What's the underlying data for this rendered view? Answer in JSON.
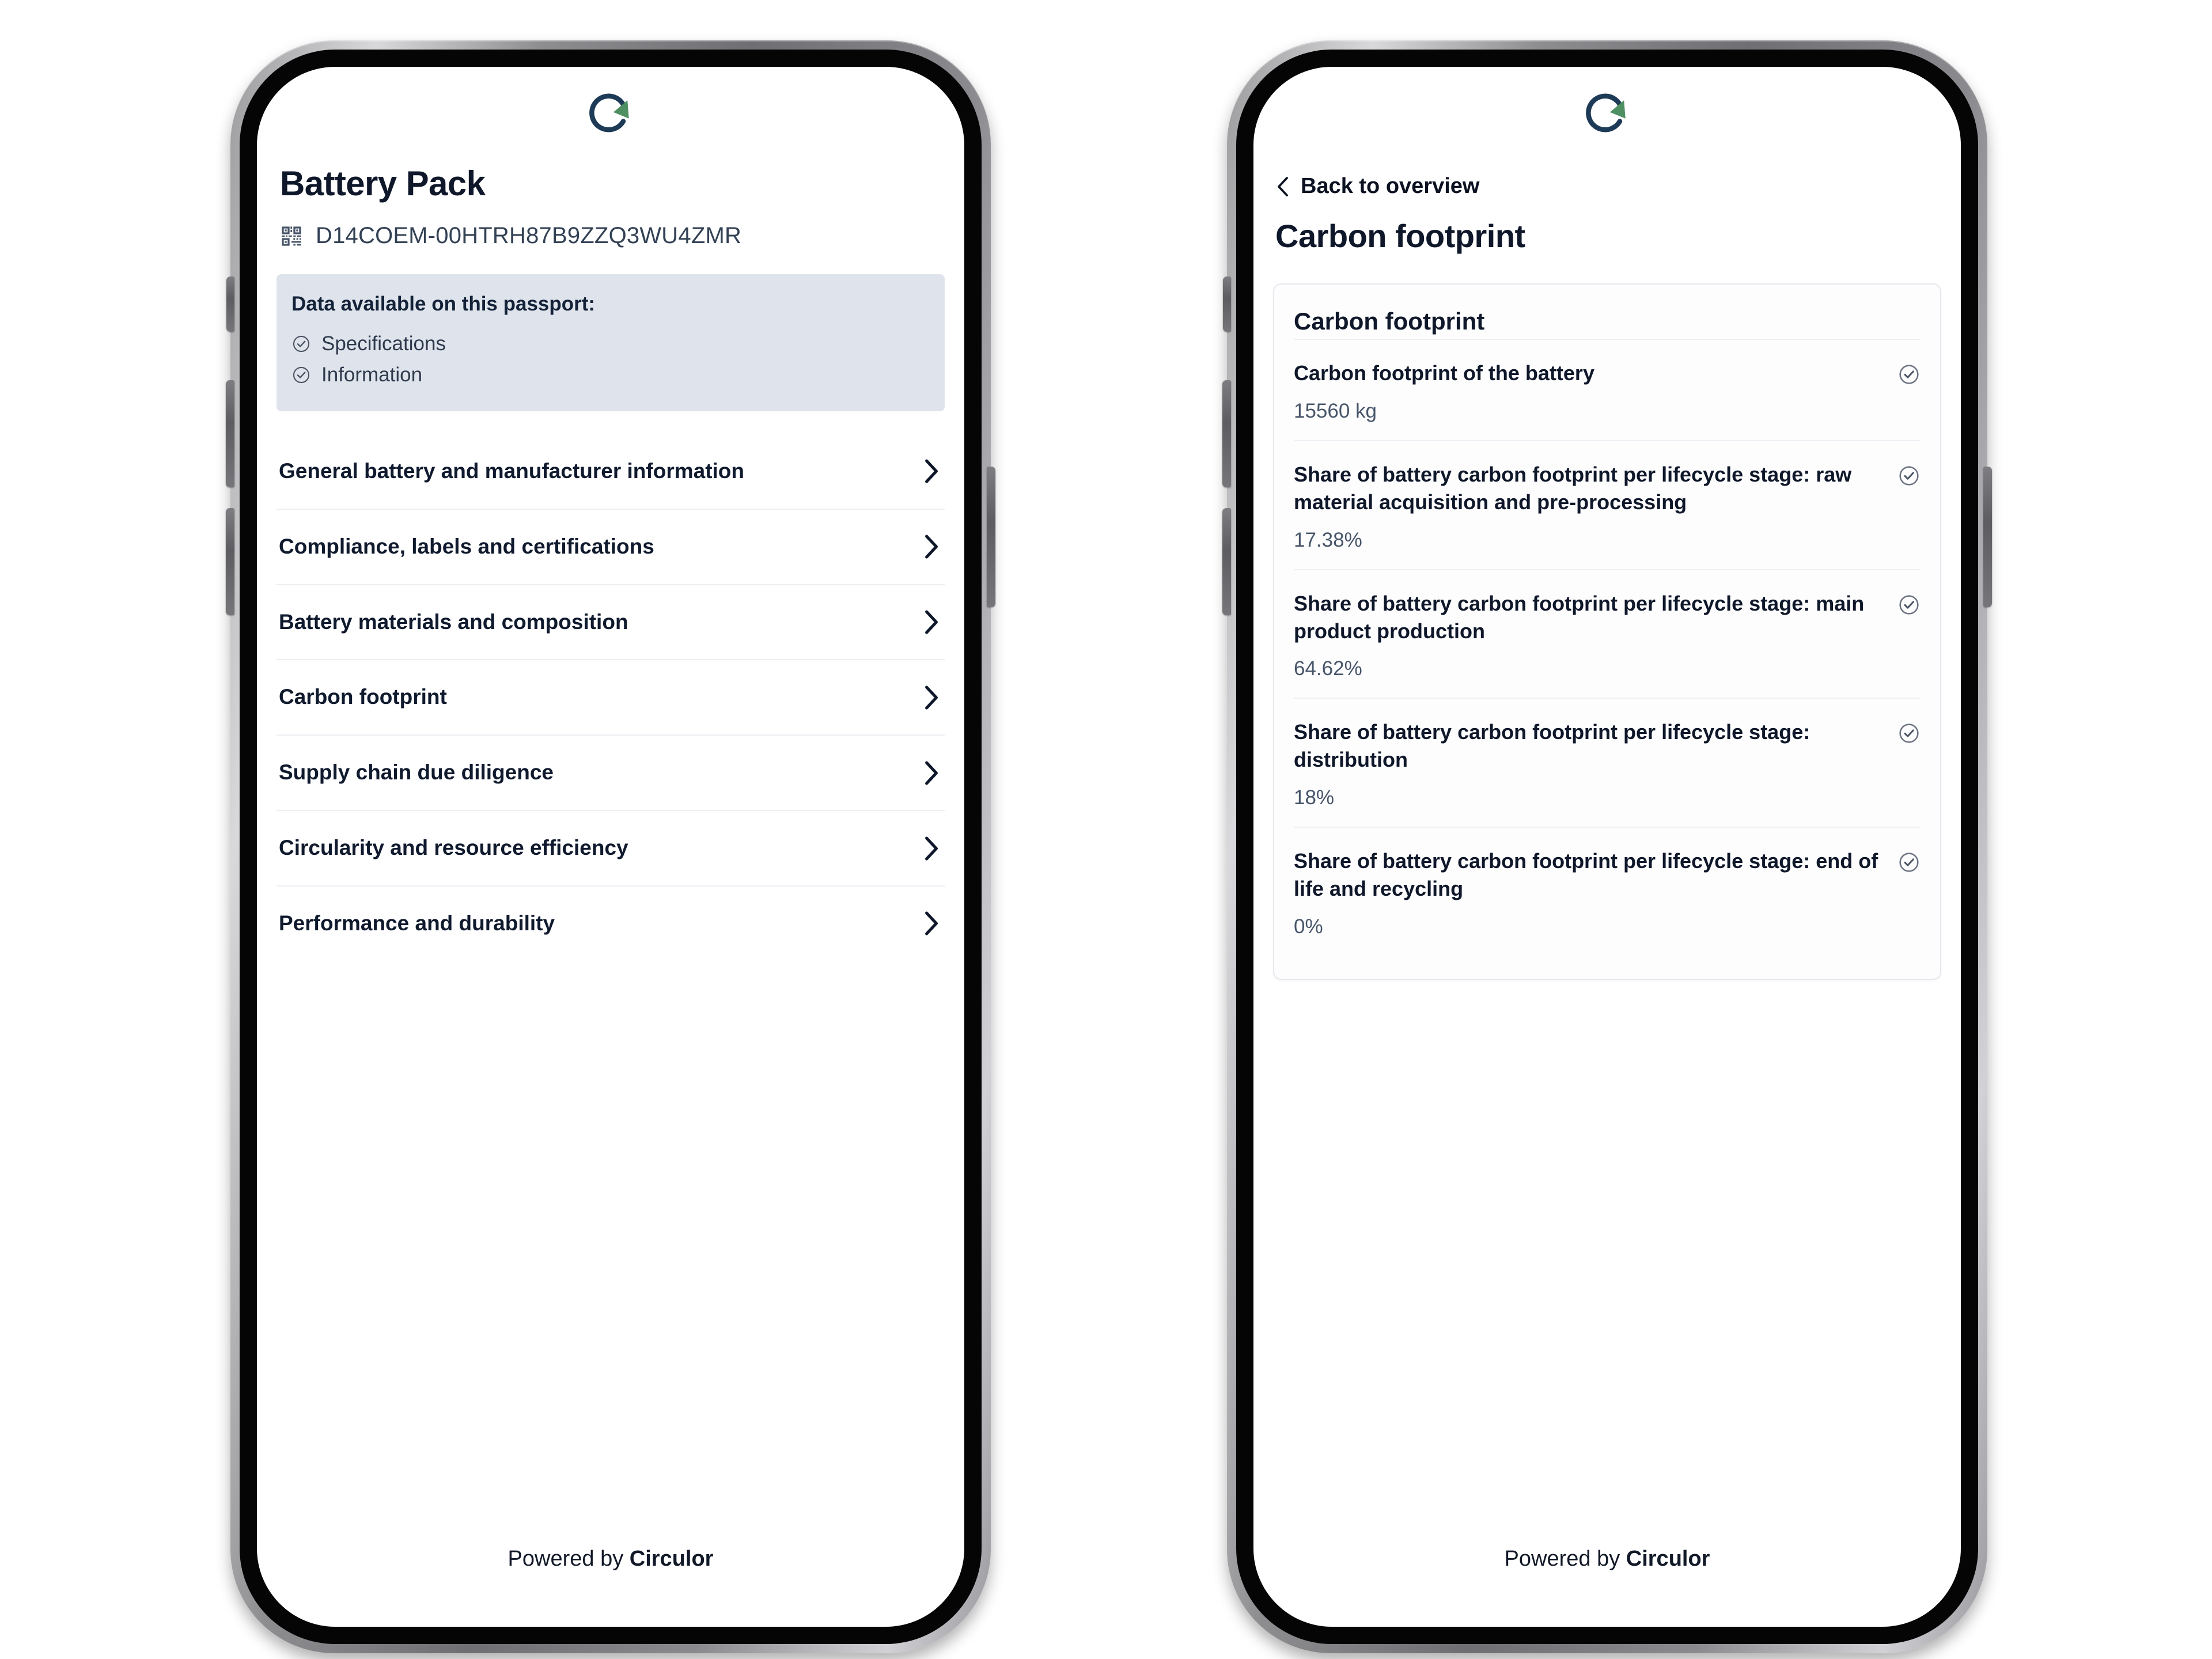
{
  "brand": {
    "logo_icon": "circular-arrow-logo",
    "logo_ring_color": "#1d3a57",
    "logo_arrow_color": "#4f9063",
    "footer_prefix": "Powered by ",
    "footer_name": "Circulor"
  },
  "left_screen": {
    "title": "Battery Pack",
    "qr_icon": "qr-code-icon",
    "passport_id": "D14COEM-00HTRH87B9ZZQ3WU4ZMR",
    "availability": {
      "heading": "Data available on this passport:",
      "items": [
        {
          "label": "Specifications",
          "icon": "check-circle-icon"
        },
        {
          "label": "Information",
          "icon": "check-circle-icon"
        }
      ],
      "background_color": "#dfe4ec"
    },
    "menu": [
      {
        "label": "General battery and manufacturer information",
        "chevron": "chevron-right-icon"
      },
      {
        "label": "Compliance, labels and certifications",
        "chevron": "chevron-right-icon"
      },
      {
        "label": "Battery materials and composition",
        "chevron": "chevron-right-icon"
      },
      {
        "label": "Carbon footprint",
        "chevron": "chevron-right-icon"
      },
      {
        "label": "Supply chain due diligence",
        "chevron": "chevron-right-icon"
      },
      {
        "label": "Circularity and resource efficiency",
        "chevron": "chevron-right-icon"
      },
      {
        "label": "Performance and durability",
        "chevron": "chevron-right-icon"
      }
    ]
  },
  "right_screen": {
    "back_icon": "chevron-left-icon",
    "back_label": "Back to overview",
    "title": "Carbon footprint",
    "card": {
      "title": "Carbon footprint",
      "rows": [
        {
          "label": "Carbon footprint of the battery",
          "value": "15560 kg",
          "icon": "check-circle-icon"
        },
        {
          "label": "Share of battery carbon footprint per lifecycle stage: raw material acquisition and pre-processing",
          "value": "17.38%",
          "icon": "check-circle-icon"
        },
        {
          "label": "Share of battery carbon footprint per lifecycle stage: main product production",
          "value": "64.62%",
          "icon": "check-circle-icon"
        },
        {
          "label": "Share of battery carbon footprint per lifecycle stage: distribution",
          "value": "18%",
          "icon": "check-circle-icon"
        },
        {
          "label": "Share of battery carbon footprint per lifecycle stage: end of life and recycling",
          "value": "0%",
          "icon": "check-circle-icon"
        }
      ]
    }
  }
}
